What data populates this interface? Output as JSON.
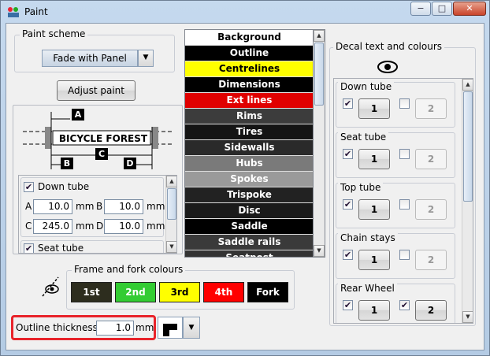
{
  "window": {
    "title": "Paint",
    "minimize": "−",
    "maximize": "□",
    "close": "✕"
  },
  "paint_scheme": {
    "label": "Paint scheme",
    "selected": "Fade with Panel"
  },
  "adjust_paint": "Adjust paint",
  "diagram": {
    "banner": "BICYCLE FOREST",
    "dims": [
      "A",
      "B",
      "C",
      "D"
    ]
  },
  "dim_panel": {
    "down_tube": "Down tube",
    "seat_tube": "Seat tube",
    "unit": "mm",
    "labels": [
      "A",
      "B",
      "C",
      "D"
    ],
    "values": [
      "10.0",
      "10.0",
      "245.0",
      "10.0"
    ]
  },
  "parts": [
    {
      "label": "Background",
      "bg": "#ffffff",
      "fg": "#000000"
    },
    {
      "label": "Outline",
      "bg": "#000000",
      "fg": "#ffffff"
    },
    {
      "label": "Centrelines",
      "bg": "#ffff00",
      "fg": "#000000"
    },
    {
      "label": "Dimensions",
      "bg": "#000000",
      "fg": "#ffffff"
    },
    {
      "label": "Ext lines",
      "bg": "#e00000",
      "fg": "#ffffff"
    },
    {
      "label": "Rims",
      "bg": "#3c3c3c",
      "fg": "#ffffff"
    },
    {
      "label": "Tires",
      "bg": "#141414",
      "fg": "#ffffff"
    },
    {
      "label": "Sidewalls",
      "bg": "#2a2a2a",
      "fg": "#ffffff"
    },
    {
      "label": "Hubs",
      "bg": "#7a7a7a",
      "fg": "#ffffff"
    },
    {
      "label": "Spokes",
      "bg": "#9a9a9a",
      "fg": "#ffffff"
    },
    {
      "label": "Trispoke",
      "bg": "#222222",
      "fg": "#ffffff"
    },
    {
      "label": "Disc",
      "bg": "#1a1a1a",
      "fg": "#ffffff"
    },
    {
      "label": "Saddle",
      "bg": "#000000",
      "fg": "#ffffff"
    },
    {
      "label": "Saddle rails",
      "bg": "#3a3a3a",
      "fg": "#ffffff"
    },
    {
      "label": "Seatpost",
      "bg": "#333333",
      "fg": "#ffffff"
    }
  ],
  "frame_fork": {
    "label": "Frame and fork colours",
    "swatches": [
      {
        "label": "1st",
        "bg": "#2d2d1e",
        "fg": "#ffffff"
      },
      {
        "label": "2nd",
        "bg": "#33cc33",
        "fg": "#ffffff"
      },
      {
        "label": "3rd",
        "bg": "#ffff00",
        "fg": "#000000"
      },
      {
        "label": "4th",
        "bg": "#ff0000",
        "fg": "#ffffff"
      },
      {
        "label": "Fork",
        "bg": "#000000",
        "fg": "#ffffff"
      }
    ]
  },
  "outline": {
    "label": "Outline thickness",
    "value": "1.0",
    "unit": "mm"
  },
  "decal": {
    "label": "Decal text and colours",
    "items": [
      {
        "label": "Down tube",
        "b1": "1",
        "b2": "2",
        "c1": true,
        "c2": false
      },
      {
        "label": "Seat tube",
        "b1": "1",
        "b2": "2",
        "c1": true,
        "c2": false
      },
      {
        "label": "Top tube",
        "b1": "1",
        "b2": "2",
        "c1": true,
        "c2": false
      },
      {
        "label": "Chain stays",
        "b1": "1",
        "b2": "2",
        "c1": true,
        "c2": false
      },
      {
        "label": "Rear Wheel",
        "b1": "1",
        "b2": "2",
        "c1": true,
        "c2": true
      }
    ]
  }
}
